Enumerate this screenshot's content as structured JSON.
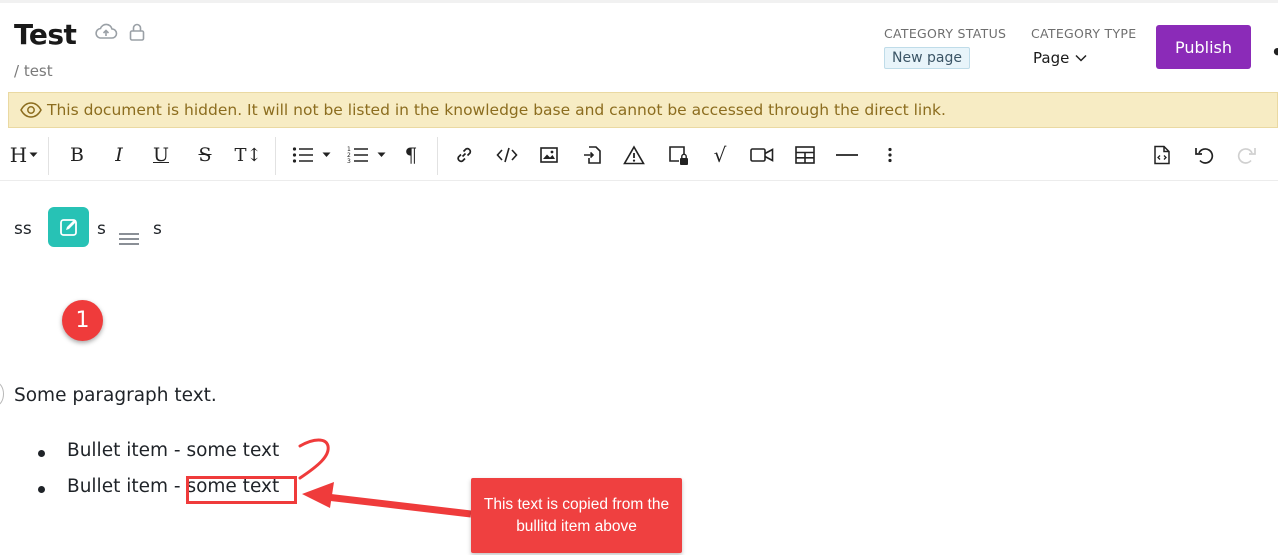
{
  "header": {
    "title": "Test",
    "breadcrumb": "/ test",
    "category_status_label": "CATEGORY STATUS",
    "category_status_value": "New page",
    "category_type_label": "CATEGORY TYPE",
    "category_type_value": "Page",
    "publish_label": "Publish",
    "more_label": "•"
  },
  "banner": {
    "text": "This document is hidden. It will not be listed in the knowledge base and cannot be accessed through the direct link."
  },
  "toolbar": {
    "heading": "H",
    "bold": "B",
    "italic": "I",
    "underline": "U",
    "strike": "S",
    "text_size": "T↕",
    "paragraph": "¶",
    "formula": "√"
  },
  "content": {
    "line_left": "ss",
    "line_mid": "s",
    "line_right": "s",
    "paragraph": "Some paragraph text.",
    "bullets": [
      "Bullet item - some text",
      "Bullet item - some text"
    ]
  },
  "annotations": {
    "step_number": "1",
    "callout_text": "This text is copied from the bullitd item above"
  },
  "colors": {
    "publish": "#8b2bb8",
    "banner_bg": "#f7ecc4",
    "banner_text": "#8c6d1f",
    "edit_button": "#27c2b5",
    "annotation_red": "#ef3b3b"
  }
}
